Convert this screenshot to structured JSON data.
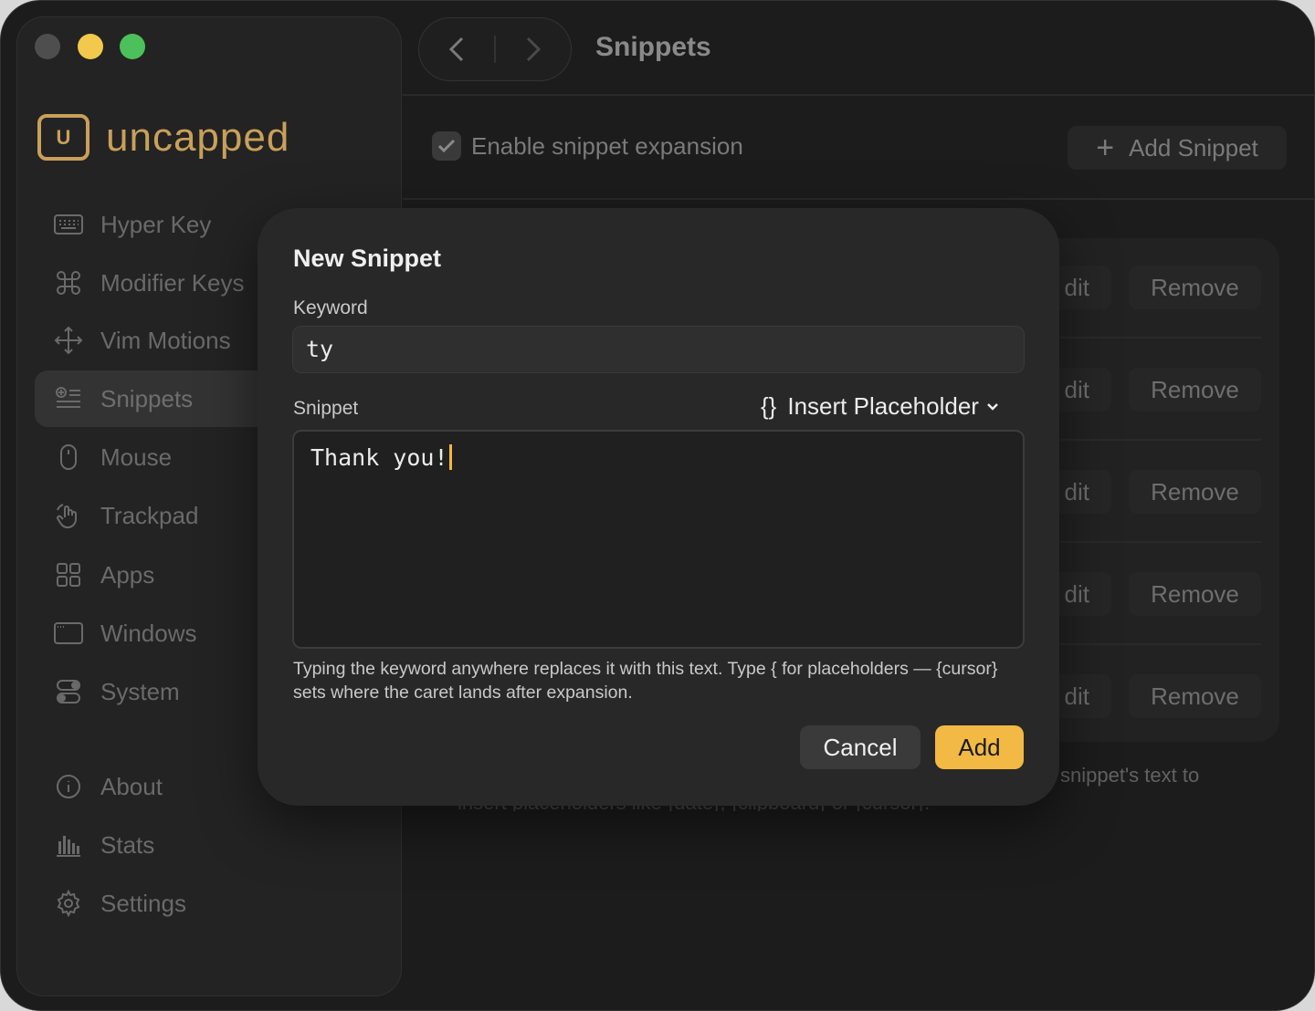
{
  "app": {
    "brand": "uncapped",
    "logo_letter": "U",
    "accent_color": "#f2b944",
    "brand_color": "#c9a05a"
  },
  "header": {
    "title": "Snippets"
  },
  "sidebar": {
    "items": [
      {
        "label": "Hyper Key",
        "icon": "keyboard-icon"
      },
      {
        "label": "Modifier Keys",
        "icon": "command-icon"
      },
      {
        "label": "Vim Motions",
        "icon": "move-arrows-icon"
      },
      {
        "label": "Snippets",
        "icon": "snippets-icon",
        "active": true
      },
      {
        "label": "Mouse",
        "icon": "mouse-icon"
      },
      {
        "label": "Trackpad",
        "icon": "trackpad-hand-icon"
      },
      {
        "label": "Apps",
        "icon": "apps-grid-icon"
      },
      {
        "label": "Windows",
        "icon": "window-icon"
      },
      {
        "label": "System",
        "icon": "toggles-icon"
      },
      {
        "label": "About",
        "icon": "info-icon"
      },
      {
        "label": "Stats",
        "icon": "bar-chart-icon"
      },
      {
        "label": "Settings",
        "icon": "gear-icon"
      }
    ]
  },
  "main": {
    "enable_label": "Enable snippet expansion",
    "enable_checked": true,
    "add_snippet_label": "Add Snippet",
    "rows": [
      {
        "edit": "dit",
        "remove": "Remove"
      },
      {
        "edit": "dit",
        "remove": "Remove"
      },
      {
        "edit": "dit",
        "remove": "Remove"
      },
      {
        "edit": "dit",
        "remove": "Remove"
      },
      {
        "edit": "dit",
        "remove": "Remove"
      }
    ],
    "footnote": "snippet's text to",
    "footnote2": "insert placeholders like {date}, {clipboard} or {cursor}."
  },
  "modal": {
    "title": "New Snippet",
    "keyword_label": "Keyword",
    "keyword_value": "ty",
    "snippet_label": "Snippet",
    "insert_placeholder": "Insert Placeholder",
    "braces": "{}",
    "snippet_value": "Thank you!",
    "help": "Typing the keyword anywhere replaces it with this text. Type { for placeholders — {cursor} sets where the caret lands after expansion.",
    "cancel": "Cancel",
    "add": "Add"
  }
}
